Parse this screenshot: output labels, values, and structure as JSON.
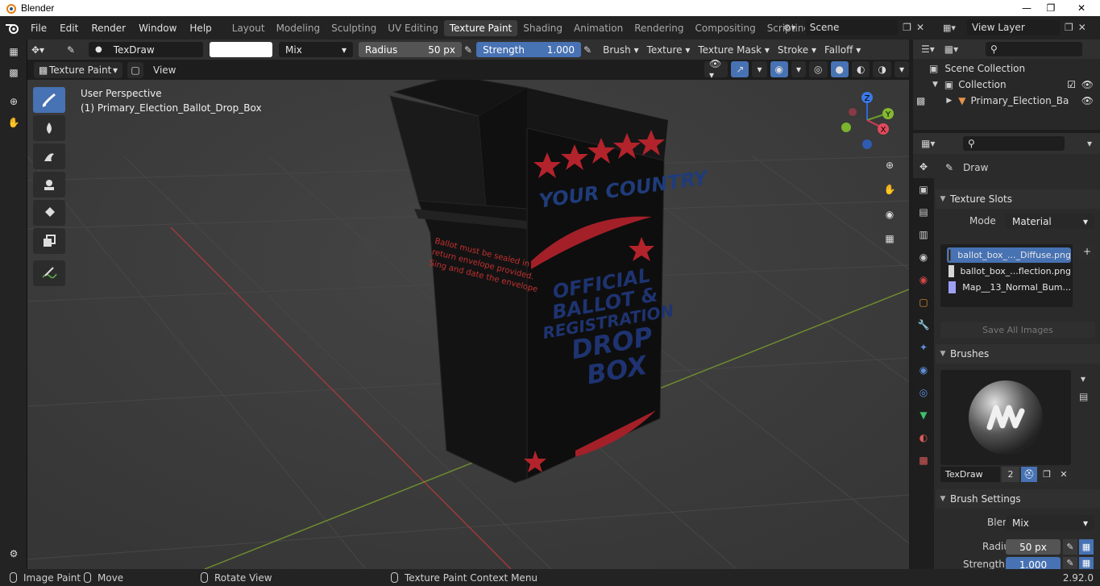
{
  "window": {
    "title": "Blender"
  },
  "menu": [
    "File",
    "Edit",
    "Render",
    "Window",
    "Help"
  ],
  "workspaces": [
    "Layout",
    "Modeling",
    "Sculpting",
    "UV Editing",
    "Texture Paint",
    "Shading",
    "Animation",
    "Rendering",
    "Compositing",
    "Scripting"
  ],
  "scene": {
    "name": "Scene",
    "view_layer": "View Layer"
  },
  "toolheader": {
    "brush_name": "TexDraw",
    "blend_mode": "Mix",
    "radius_label": "Radius",
    "radius_value": "50 px",
    "strength_label": "Strength",
    "strength_value": "1.000",
    "menus": [
      "Brush",
      "Texture",
      "Texture Mask",
      "Stroke",
      "Falloff"
    ]
  },
  "vpheader": {
    "mode": "Texture Paint",
    "view": "View"
  },
  "viewport": {
    "perspective": "User Perspective",
    "object": "(1) Primary_Election_Ballot_Drop_Box",
    "box_text": {
      "top": "YOUR COUNTRY",
      "l1": "OFFICIAL",
      "l2": "BALLOT &",
      "l3": "REGISTRATION",
      "l4": "DROP",
      "l5": "BOX",
      "side1": "Ballot must be sealed in",
      "side2": "return envelope provided.",
      "side3": "Sing and date the envelope"
    },
    "gizmo": {
      "z": "Z",
      "y": "Y",
      "x": "X"
    }
  },
  "outliner": {
    "scene_collection": "Scene Collection",
    "collection": "Collection",
    "object": "Primary_Election_Ba"
  },
  "properties": {
    "tool": "Draw",
    "texture_slots": {
      "title": "Texture Slots",
      "mode_label": "Mode",
      "mode_value": "Material",
      "slots": [
        "ballot_box_..._Diffuse.png",
        "ballot_box_...flection.png",
        "Map__13_Normal_Bum..."
      ],
      "save_all": "Save All Images"
    },
    "brushes": {
      "title": "Brushes",
      "name": "TexDraw",
      "users": "2"
    },
    "brush_settings": {
      "title": "Brush Settings",
      "blend_label": "Blend",
      "blend_value": "Mix",
      "radius_label": "Radius",
      "radius_value": "50 px",
      "strength_label": "Strength",
      "strength_value": "1.000"
    }
  },
  "statusbar": {
    "item1": "Image Paint",
    "item2": "Move",
    "item3": "Rotate View",
    "item4": "Texture Paint Context Menu",
    "version": "2.92.0"
  }
}
